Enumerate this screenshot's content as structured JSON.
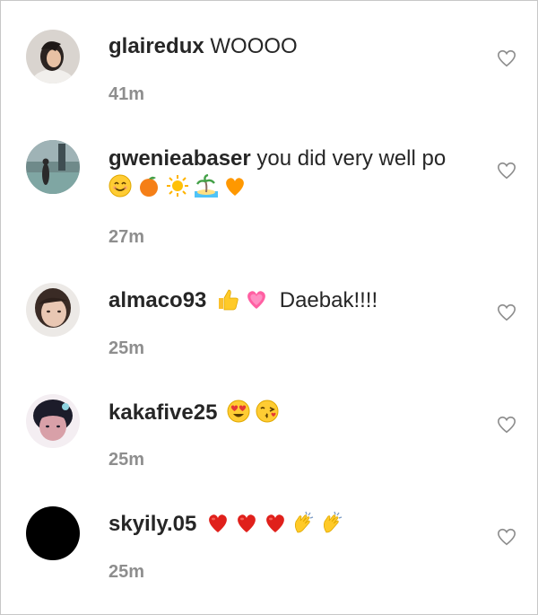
{
  "comments": [
    {
      "username": "glairedux",
      "message": "WOOOO",
      "time": "41m",
      "emojis": []
    },
    {
      "username": "gwenieabaser",
      "message": "you did very well po",
      "time": "27m",
      "emojis": [
        "smiling-face-emoji",
        "tangerine-emoji",
        "sun-emoji",
        "desert-island-emoji",
        "orange-heart-emoji"
      ]
    },
    {
      "username": "almaco93",
      "message": "Daebak!!!!",
      "time": "25m",
      "emojis": [
        "thumbs-up-emoji",
        "growing-heart-emoji"
      ]
    },
    {
      "username": "kakafive25",
      "message": "",
      "time": "25m",
      "emojis": [
        "heart-eyes-emoji",
        "kissing-face-emoji"
      ]
    },
    {
      "username": "skyily.05",
      "message": "",
      "time": "25m",
      "emojis": [
        "red-heart-emoji",
        "red-heart-emoji",
        "red-heart-emoji",
        "clapping-hands-emoji",
        "clapping-hands-emoji"
      ]
    }
  ],
  "colors": {
    "username": "#262626",
    "timestamp": "#8e8e8e",
    "like_icon": "#8e8e8e"
  }
}
